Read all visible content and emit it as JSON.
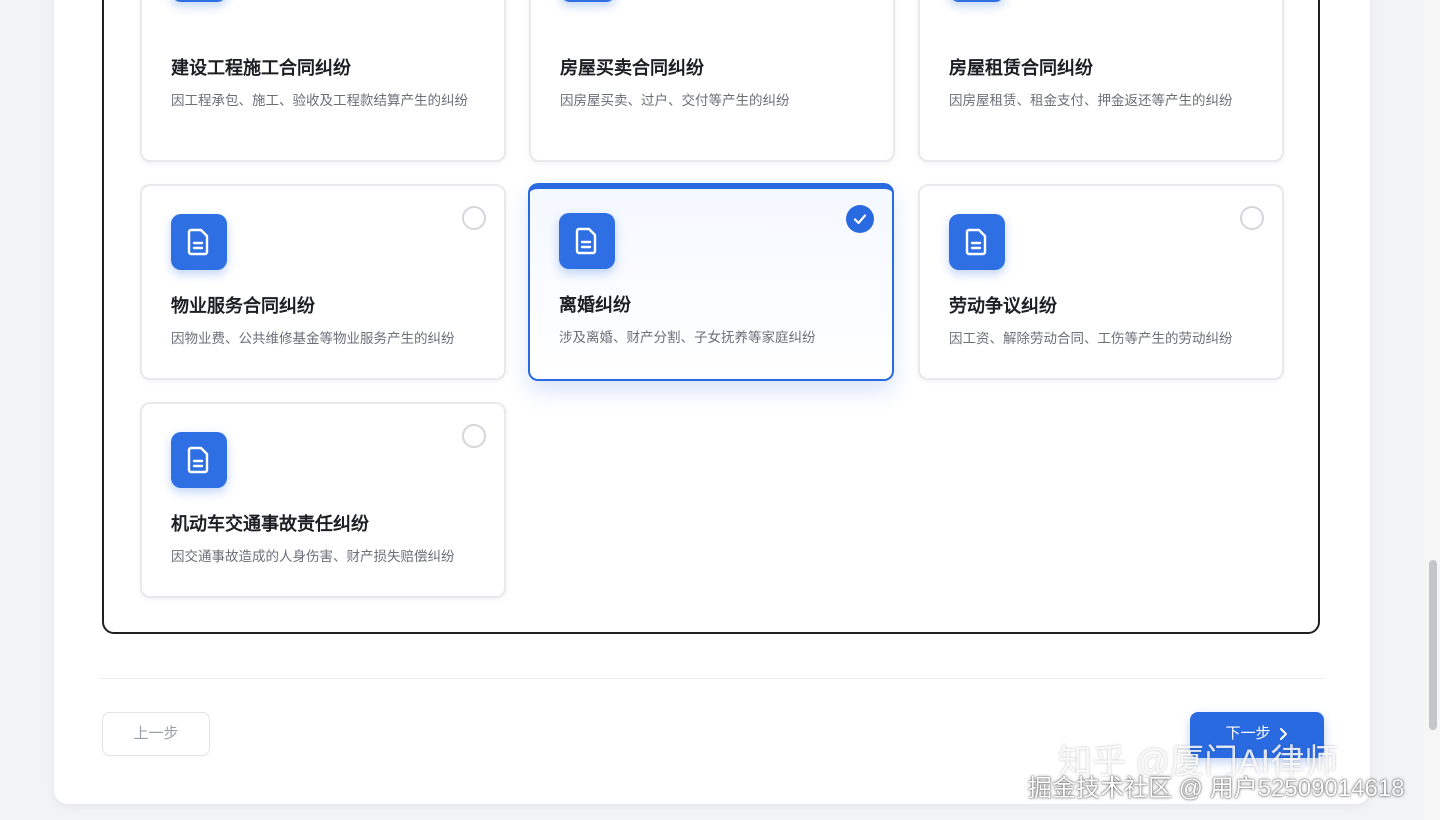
{
  "cards": [
    {
      "title": "建设工程施工合同纠纷",
      "desc": "因工程承包、施工、验收及工程款结算产生的纠纷",
      "icon": "document-icon",
      "selected": false
    },
    {
      "title": "房屋买卖合同纠纷",
      "desc": "因房屋买卖、过户、交付等产生的纠纷",
      "icon": "document-icon",
      "selected": false
    },
    {
      "title": "房屋租赁合同纠纷",
      "desc": "因房屋租赁、租金支付、押金返还等产生的纠纷",
      "icon": "document-icon",
      "selected": false
    },
    {
      "title": "物业服务合同纠纷",
      "desc": "因物业费、公共维修基金等物业服务产生的纠纷",
      "icon": "document-icon",
      "selected": false
    },
    {
      "title": "离婚纠纷",
      "desc": "涉及离婚、财产分割、子女抚养等家庭纠纷",
      "icon": "document-icon",
      "selected": true
    },
    {
      "title": "劳动争议纠纷",
      "desc": "因工资、解除劳动合同、工伤等产生的劳动纠纷",
      "icon": "document-icon",
      "selected": false
    },
    {
      "title": "机动车交通事故责任纠纷",
      "desc": "因交通事故造成的人身伤害、财产损失赔偿纠纷",
      "icon": "document-icon",
      "selected": false
    }
  ],
  "footer": {
    "prev_label": "上一步",
    "next_label": "下一步"
  },
  "watermarks": {
    "line1": "知乎 @厦门AI律师",
    "line2": "掘金技术社区 @ 用户52509014618"
  },
  "colors": {
    "accent": "#2a6ae0",
    "text_primary": "#1d1f24",
    "text_secondary": "#6b6f78"
  }
}
